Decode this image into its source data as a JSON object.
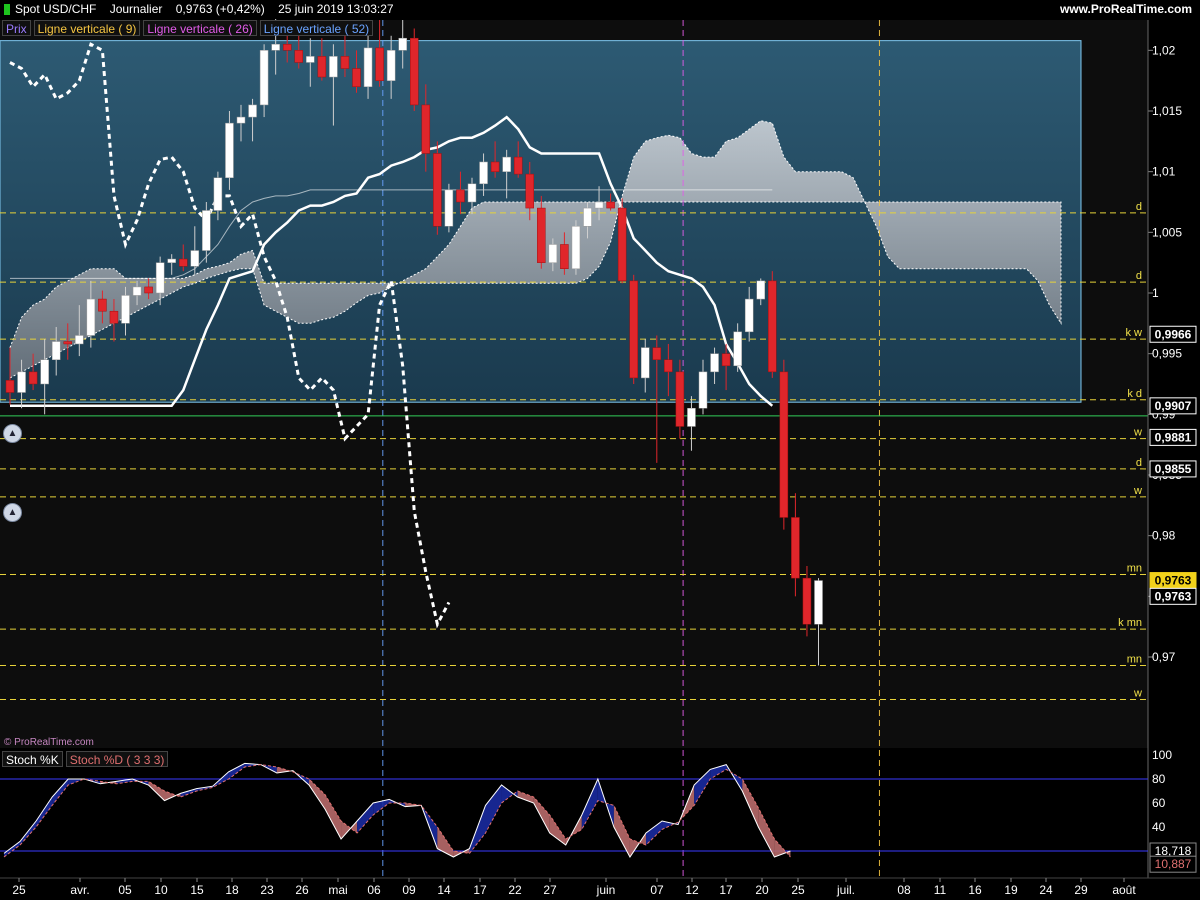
{
  "header": {
    "title": "Spot USD/CHF    Journalier    0,9763 (+0,42%)    25 juin 2019 13:03:27",
    "brand": "www.ProRealTime.com"
  },
  "legend": [
    {
      "label": "Prix",
      "color": "#9b7bff"
    },
    {
      "label": "Ligne verticale ( 9)",
      "color": "#f5c542"
    },
    {
      "label": "Ligne verticale ( 26)",
      "color": "#e15ce9"
    },
    {
      "label": "Ligne verticale ( 52)",
      "color": "#6aa3ff"
    }
  ],
  "watermark": "© ProRealTime.com",
  "stoch_legend": [
    {
      "label": "Stoch %K",
      "color": "#ffffff"
    },
    {
      "label": "Stoch %D ( 3 3 3)",
      "color": "#e07070"
    }
  ],
  "chart_data": {
    "type": "candlestick",
    "instrument": "Spot USD/CHF",
    "timeframe": "Journalier",
    "ylim": [
      0.9625,
      1.0225
    ],
    "yticks": [
      {
        "v": 1.02,
        "label": "1,02"
      },
      {
        "v": 1.015,
        "label": "1,015"
      },
      {
        "v": 1.01,
        "label": "1,01"
      },
      {
        "v": 1.005,
        "label": "1,005"
      },
      {
        "v": 1.0,
        "label": "1"
      },
      {
        "v": 0.995,
        "label": "0,995"
      },
      {
        "v": 0.99,
        "label": "0,99"
      },
      {
        "v": 0.985,
        "label": "0,985"
      },
      {
        "v": 0.98,
        "label": "0,98"
      },
      {
        "v": 0.975,
        "label": "0,975"
      },
      {
        "v": 0.97,
        "label": "0,97"
      }
    ],
    "xticks": [
      "25",
      "avr.",
      "05",
      "10",
      "15",
      "18",
      "23",
      "26",
      "mai",
      "06",
      "09",
      "14",
      "17",
      "22",
      "27",
      "juin",
      "07",
      "12",
      "17",
      "20",
      "25",
      "juil.",
      "08",
      "11",
      "16",
      "19",
      "24",
      "29",
      "août"
    ],
    "candles": [
      [
        0.9928,
        0.9955,
        0.9908,
        0.9918
      ],
      [
        0.9918,
        0.9945,
        0.9905,
        0.9935
      ],
      [
        0.9935,
        0.995,
        0.992,
        0.9925
      ],
      [
        0.9925,
        0.9962,
        0.99,
        0.9945
      ],
      [
        0.9945,
        0.9972,
        0.9932,
        0.996
      ],
      [
        0.996,
        0.9975,
        0.9945,
        0.9958
      ],
      [
        0.9958,
        0.999,
        0.9948,
        0.9965
      ],
      [
        0.9965,
        1.001,
        0.9955,
        0.9995
      ],
      [
        0.9995,
        1.0002,
        0.9975,
        0.9985
      ],
      [
        0.9985,
        0.9995,
        0.996,
        0.9975
      ],
      [
        0.9975,
        1.0005,
        0.9965,
        0.9998
      ],
      [
        0.9998,
        1.001,
        0.999,
        1.0005
      ],
      [
        1.0005,
        1.0012,
        0.9995,
        1.0
      ],
      [
        1.0,
        1.003,
        0.999,
        1.0025
      ],
      [
        1.0025,
        1.0032,
        1.0015,
        1.0028
      ],
      [
        1.0028,
        1.004,
        1.0018,
        1.0022
      ],
      [
        1.0022,
        1.0055,
        1.0015,
        1.0035
      ],
      [
        1.0035,
        1.0075,
        1.0025,
        1.0068
      ],
      [
        1.0068,
        1.01,
        1.006,
        1.0095
      ],
      [
        1.0095,
        1.015,
        1.0085,
        1.014
      ],
      [
        1.014,
        1.0155,
        1.0125,
        1.0145
      ],
      [
        1.0145,
        1.016,
        1.0125,
        1.0155
      ],
      [
        1.0155,
        1.0205,
        1.0145,
        1.02
      ],
      [
        1.02,
        1.023,
        1.018,
        1.0205
      ],
      [
        1.0205,
        1.0225,
        1.019,
        1.02
      ],
      [
        1.02,
        1.0215,
        1.0185,
        1.019
      ],
      [
        1.019,
        1.021,
        1.017,
        1.0195
      ],
      [
        1.0195,
        1.021,
        1.0175,
        1.0178
      ],
      [
        1.0178,
        1.0205,
        1.0138,
        1.0195
      ],
      [
        1.0195,
        1.0215,
        1.0178,
        1.0185
      ],
      [
        1.0185,
        1.02,
        1.0165,
        1.017
      ],
      [
        1.017,
        1.0215,
        1.016,
        1.0202
      ],
      [
        1.0202,
        1.0225,
        1.017,
        1.0175
      ],
      [
        1.0175,
        1.0212,
        1.016,
        1.02
      ],
      [
        1.02,
        1.0225,
        1.0185,
        1.021
      ],
      [
        1.021,
        1.0218,
        1.015,
        1.0155
      ],
      [
        1.0155,
        1.0172,
        1.01,
        1.0115
      ],
      [
        1.0115,
        1.0125,
        1.0048,
        1.0055
      ],
      [
        1.0055,
        1.009,
        1.005,
        1.0085
      ],
      [
        1.0085,
        1.01,
        1.0065,
        1.0075
      ],
      [
        1.0075,
        1.0095,
        1.0065,
        1.009
      ],
      [
        1.009,
        1.0115,
        1.008,
        1.0108
      ],
      [
        1.0108,
        1.0125,
        1.0095,
        1.01
      ],
      [
        1.01,
        1.0118,
        1.0078,
        1.0112
      ],
      [
        1.0112,
        1.0125,
        1.0095,
        1.0098
      ],
      [
        1.0098,
        1.0108,
        1.006,
        1.007
      ],
      [
        1.007,
        1.008,
        1.002,
        1.0025
      ],
      [
        1.0025,
        1.0045,
        1.0018,
        1.004
      ],
      [
        1.004,
        1.005,
        1.0015,
        1.002
      ],
      [
        1.002,
        1.006,
        1.0015,
        1.0055
      ],
      [
        1.0055,
        1.0075,
        1.0045,
        1.007
      ],
      [
        1.007,
        1.0088,
        1.006,
        1.0075
      ],
      [
        1.0075,
        1.0082,
        1.0068,
        1.007
      ],
      [
        1.007,
        1.0078,
        1.0008,
        1.001
      ],
      [
        1.001,
        1.0015,
        0.9925,
        0.993
      ],
      [
        0.993,
        0.9962,
        0.9918,
        0.9955
      ],
      [
        0.9955,
        0.9965,
        0.986,
        0.9945
      ],
      [
        0.9945,
        0.9958,
        0.9915,
        0.9935
      ],
      [
        0.9935,
        0.9945,
        0.988,
        0.989
      ],
      [
        0.989,
        0.9915,
        0.987,
        0.9905
      ],
      [
        0.9905,
        0.9945,
        0.99,
        0.9935
      ],
      [
        0.9935,
        0.9955,
        0.9925,
        0.995
      ],
      [
        0.995,
        0.9958,
        0.992,
        0.994
      ],
      [
        0.994,
        0.9975,
        0.9935,
        0.9968
      ],
      [
        0.9968,
        1.0005,
        0.996,
        0.9995
      ],
      [
        0.9995,
        1.0012,
        0.999,
        1.001
      ],
      [
        1.001,
        1.0018,
        0.993,
        0.9935
      ],
      [
        0.9935,
        0.9945,
        0.9805,
        0.9815
      ],
      [
        0.9815,
        0.9835,
        0.975,
        0.9765
      ],
      [
        0.9765,
        0.9775,
        0.9717,
        0.9727
      ],
      [
        0.9727,
        0.9765,
        0.9693,
        0.9763
      ]
    ],
    "ichimoku": {
      "tenkan": [
        0.9907,
        0.9907,
        0.9907,
        0.9907,
        0.9907,
        0.9907,
        0.9907,
        0.9907,
        0.9907,
        0.9907,
        0.9907,
        0.9907,
        0.9907,
        0.9907,
        0.9907,
        0.992,
        0.9945,
        0.997,
        0.999,
        1.0012,
        1.0015,
        1.0018,
        1.004,
        1.005,
        1.0058,
        1.0068,
        1.0072,
        1.0072,
        1.0075,
        1.008,
        1.0082,
        1.0095,
        1.0098,
        1.0105,
        1.0108,
        1.0112,
        1.0118,
        1.012,
        1.0125,
        1.0128,
        1.0128,
        1.0132,
        1.0138,
        1.0145,
        1.0135,
        1.012,
        1.0115,
        1.0115,
        1.0115,
        1.0115,
        1.0115,
        1.0115,
        1.009,
        1.007,
        1.0045,
        1.0035,
        1.0025,
        1.0018,
        1.0015,
        1.0012,
        1.0005,
        0.999,
        0.9958,
        0.9942,
        0.9925,
        0.9915,
        0.9907
      ],
      "kijun": [
        1.0012,
        1.0012,
        1.0012,
        1.0012,
        1.0012,
        1.0012,
        1.0012,
        1.0012,
        1.0012,
        1.0012,
        1.0012,
        1.0012,
        1.0012,
        1.0012,
        1.0012,
        1.0015,
        1.002,
        1.003,
        1.004,
        1.0055,
        1.0068,
        1.0075,
        1.0078,
        1.008,
        1.008,
        1.0082,
        1.0085,
        1.0085,
        1.0085,
        1.0085,
        1.0085,
        1.0085,
        1.0085,
        1.0085,
        1.0085,
        1.0085,
        1.0085,
        1.0085,
        1.0085,
        1.0085,
        1.0085,
        1.0085,
        1.0085,
        1.0085,
        1.0085,
        1.0085,
        1.0085,
        1.0085,
        1.0085,
        1.0085,
        1.0085,
        1.0085,
        1.0085,
        1.0085,
        1.0085,
        1.0085,
        1.0085,
        1.0085,
        1.0085,
        1.0085,
        1.0085,
        1.0085,
        1.0085,
        1.0085,
        1.0085,
        1.0085,
        1.0085
      ],
      "chikou_x_start": 0,
      "chikou": [
        1.019,
        1.0185,
        1.017,
        1.018,
        1.016,
        1.0165,
        1.0175,
        1.0205,
        1.02,
        1.008,
        1.004,
        1.006,
        1.009,
        1.011,
        1.0112,
        1.01,
        1.007,
        1.006,
        1.008,
        1.008,
        1.0055,
        1.0065,
        1.003,
        1.001,
        0.998,
        0.993,
        0.992,
        0.993,
        0.992,
        0.988,
        0.989,
        0.99,
        0.999,
        1.001,
        0.994,
        0.982,
        0.977,
        0.9727,
        0.9745
      ]
    },
    "cloud": {
      "upper": [
        0.9955,
        0.998,
        0.999,
        0.9995,
        1.0005,
        1.001,
        1.0015,
        1.002,
        1.002,
        1.002,
        1.0012,
        1.0012,
        1.0012,
        1.0012,
        1.0012,
        1.0012,
        1.0015,
        1.002,
        1.0022,
        1.0025,
        1.0032,
        1.0035,
        1.0008,
        1.0008,
        1.0008,
        1.0008,
        1.0008,
        1.0008,
        1.0008,
        1.0008,
        1.0008,
        1.0008,
        1.0008,
        1.0008,
        1.0008,
        1.0008,
        1.0008,
        1.0008,
        1.0008,
        1.0008,
        1.0008,
        1.0008,
        1.0008,
        1.0008,
        1.0008,
        1.0008,
        1.0008,
        1.0008,
        1.0008,
        1.0008,
        1.0012,
        1.0022,
        1.0042,
        1.008,
        1.0112,
        1.0125,
        1.0128,
        1.013,
        1.0128,
        1.0115,
        1.0112,
        1.0112,
        1.0125,
        1.0128,
        1.0135,
        1.0142,
        1.014,
        1.0112,
        1.01,
        1.01,
        1.01,
        1.01,
        1.01,
        1.0095,
        1.0075,
        1.0055,
        1.003,
        1.002,
        1.002,
        1.002,
        1.002,
        1.002,
        1.002,
        1.002,
        1.002,
        1.002,
        1.002,
        1.002,
        1.002,
        1.001,
        0.999,
        0.9975
      ],
      "lower": [
        0.993,
        0.9935,
        0.994,
        0.9945,
        0.995,
        0.9955,
        0.996,
        0.9965,
        0.997,
        0.9975,
        0.998,
        0.9985,
        0.999,
        0.9995,
        1.0,
        1.0005,
        1.0008,
        1.0012,
        1.0015,
        1.0018,
        1.002,
        1.002,
        0.999,
        0.9985,
        0.998,
        0.9975,
        0.9975,
        0.9978,
        0.998,
        0.9985,
        0.9992,
        0.9998,
        1.0,
        1.0005,
        1.001,
        1.0015,
        1.002,
        1.003,
        1.004,
        1.0055,
        1.007,
        1.0075,
        1.0075,
        1.0075,
        1.0075,
        1.0075,
        1.0075,
        1.0075,
        1.0075,
        1.0075,
        1.0075,
        1.0075,
        1.0075,
        1.0075,
        1.0075,
        1.0075,
        1.0075,
        1.0075,
        1.0075,
        1.0075,
        1.0075,
        1.0075,
        1.0075,
        1.0075,
        1.0075,
        1.0075,
        1.0075,
        1.0075,
        1.0075,
        1.0075,
        1.0075,
        1.0075,
        1.0075,
        1.0075,
        1.0075,
        1.0075,
        1.0075,
        1.0075,
        1.0075,
        1.0075,
        1.0075,
        1.0075,
        1.0075,
        1.0075,
        1.0075,
        1.0075,
        1.0075,
        1.0075,
        1.0075,
        1.0075,
        1.0075,
        1.0075
      ]
    },
    "kumo_box": {
      "v_top": 1.0208,
      "v_bottom": 0.991
    },
    "vlines": [
      {
        "bar": 16,
        "color": "#6aa3ff"
      },
      {
        "bar": 42,
        "color": "#e15ce9"
      },
      {
        "bar": 59,
        "color": "#f5c542"
      }
    ],
    "hlines": [
      {
        "v": 1.0066,
        "label": "d"
      },
      {
        "v": 1.0009,
        "label": "d"
      },
      {
        "v": 0.9962,
        "label": "k w"
      },
      {
        "v": 0.9912,
        "label": "k d"
      },
      {
        "v": 0.988,
        "label": "w"
      },
      {
        "v": 0.9855,
        "label": "d"
      },
      {
        "v": 0.9832,
        "label": "w"
      },
      {
        "v": 0.9768,
        "label": "mn"
      },
      {
        "v": 0.9723,
        "label": "k mn"
      },
      {
        "v": 0.9693,
        "label": "mn"
      },
      {
        "v": 0.9665,
        "label": "w"
      }
    ],
    "price_tags": [
      {
        "v": 0.9966,
        "label": "0,9966",
        "bg": "#000",
        "fg": "#fff",
        "border": "#fff"
      },
      {
        "v": 0.9907,
        "label": "0,9907",
        "bg": "#000",
        "fg": "#fff",
        "border": "#fff"
      },
      {
        "v": 0.9881,
        "label": "0,9881",
        "bg": "#000",
        "fg": "#fff",
        "border": "#fff"
      },
      {
        "v": 0.9855,
        "label": "0,9855",
        "bg": "#000",
        "fg": "#fff",
        "border": "#fff"
      },
      {
        "v": 0.9763,
        "label": "0,9763",
        "bg": "#f2d21b",
        "fg": "#000",
        "border": "#f2d21b"
      },
      {
        "v": 0.975,
        "label": "0,9763",
        "bg": "#000",
        "fg": "#fff",
        "border": "#fff"
      }
    ],
    "stoch": {
      "ylim": [
        0,
        100
      ],
      "yticks": [
        20,
        40,
        60,
        80,
        100
      ],
      "hlines": [
        20,
        80
      ],
      "k": [
        18,
        28,
        45,
        65,
        80,
        80,
        76,
        78,
        80,
        75,
        62,
        68,
        72,
        74,
        86,
        93,
        92,
        85,
        87,
        75,
        55,
        30,
        45,
        60,
        63,
        57,
        58,
        22,
        15,
        22,
        58,
        75,
        65,
        60,
        35,
        25,
        50,
        80,
        40,
        15,
        35,
        45,
        42,
        75,
        88,
        92,
        70,
        40,
        15,
        20
      ],
      "d": [
        15,
        25,
        40,
        58,
        75,
        80,
        78,
        76,
        78,
        78,
        70,
        65,
        70,
        73,
        80,
        90,
        92,
        90,
        86,
        80,
        67,
        45,
        35,
        50,
        60,
        60,
        58,
        40,
        20,
        18,
        35,
        60,
        70,
        65,
        50,
        30,
        38,
        62,
        58,
        30,
        25,
        38,
        44,
        58,
        80,
        88,
        80,
        56,
        30,
        15
      ],
      "tags": [
        {
          "v": 20,
          "label": "18,718",
          "bg": "#000",
          "fg": "#fff"
        },
        {
          "v": 9,
          "label": "10,887",
          "bg": "#000",
          "fg": "#e07070"
        }
      ]
    }
  }
}
